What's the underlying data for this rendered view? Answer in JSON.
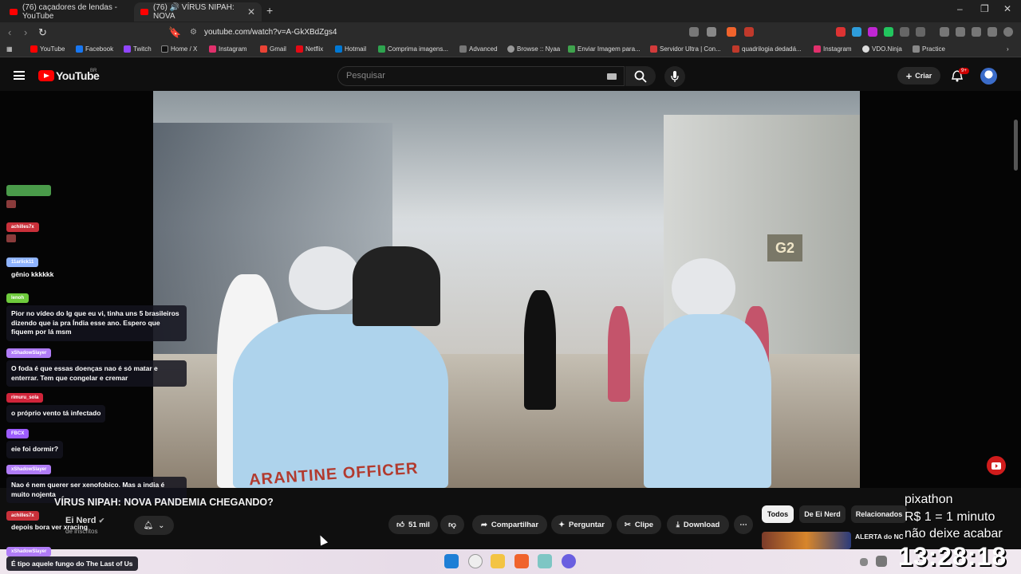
{
  "browser": {
    "tabs": [
      {
        "label": "(76) caçadores de lendas - YouTube"
      },
      {
        "label": "(76) 🔊 VÍRUS NIPAH: NOVA"
      }
    ],
    "url": "youtube.com/watch?v=A-GkXBdZgs4",
    "bookmarks": [
      {
        "label": "YouTube",
        "color": "#ff0000"
      },
      {
        "label": "Facebook",
        "color": "#1877f2"
      },
      {
        "label": "Twitch",
        "color": "#9146ff"
      },
      {
        "label": "Home / X",
        "color": "#222222"
      },
      {
        "label": "Instagram",
        "color": "#e1306c"
      },
      {
        "label": "Gmail",
        "color": "#ea4335"
      },
      {
        "label": "Netflix",
        "color": "#e50914"
      },
      {
        "label": "Hotmail",
        "color": "#0078d4"
      },
      {
        "label": "Comprima imagens...",
        "color": "#2ea44f"
      },
      {
        "label": "Advanced",
        "color": "#777777"
      },
      {
        "label": "Browse :: Nyaa",
        "color": "#999999"
      },
      {
        "label": "Enviar Imagem para...",
        "color": "#3fa34d"
      },
      {
        "label": "Servidor Ultra | Con...",
        "color": "#d33b3b"
      },
      {
        "label": "quadrilogia dedadá...",
        "color": "#c0392b"
      },
      {
        "label": "Instagram",
        "color": "#e1306c"
      },
      {
        "label": "VDO.Ninja",
        "color": "#dddddd"
      },
      {
        "label": "Practice",
        "color": "#888888"
      }
    ]
  },
  "youtube": {
    "logo_text": "YouTube",
    "country_code": "BR",
    "search_placeholder": "Pesquisar",
    "create_label": "Criar",
    "notification_count": "9+"
  },
  "video": {
    "title": "VÍRUS NIPAH: NOVA PANDEMIA CHEGANDO?",
    "gate_sign": "G2",
    "officer_text": "ARANTINE OFFICER",
    "channel": "Ei Nerd",
    "subscribers": "de inscritos",
    "likes": "51 mil",
    "share_label": "Compartilhar",
    "ask_label": "Perguntar",
    "clip_label": "Clipe",
    "download_label": "Download"
  },
  "chips": [
    "Todos",
    "De Ei Nerd",
    "Relacionados"
  ],
  "recommendation": {
    "title": "ALERTA do NOVO NIPAH! CASOS CONFIRMADOS"
  },
  "chat": [
    {
      "user": "",
      "message": "",
      "name_color": "#4a9b4a"
    },
    {
      "user": "achilles7x",
      "message": "",
      "name_color": "#c9303a"
    },
    {
      "user": "11arlick11",
      "message": "gênio kkkkkk",
      "name_color": "#8fb4ff"
    },
    {
      "user": "lenoh",
      "message": "Pior no vídeo do Ig que eu vi, tinha uns 5 brasileiros dizendo que ia pra Índia esse ano. Espero que fiquem por lá msm",
      "name_color": "#6ecb3c"
    },
    {
      "user": "xShadowSlayer",
      "message": "O foda é que essas doenças nao é só matar e enterrar. Tem que congelar e cremar",
      "name_color": "#b07cf7"
    },
    {
      "user": "rimuru_sola",
      "message": "o próprio vento tá infectado",
      "name_color": "#d0243a"
    },
    {
      "user": "FBCX",
      "message": "eie foi dormir?",
      "name_color": "#9d5cff"
    },
    {
      "user": "xShadowSlayer",
      "message": "Nao é nem querer ser xenofobico. Mas a india é muito nojenta",
      "name_color": "#b07cf7"
    },
    {
      "user": "achilles7x",
      "message": "depois bora ver xracing",
      "name_color": "#c9303a"
    },
    {
      "user": "xShadowSlayer",
      "message": "É tipo aquele fungo do The Last of Us",
      "name_color": "#b07cf7"
    }
  ],
  "overlay": {
    "line1": "pixathon",
    "line2": "R$ 1 = 1 minuto",
    "line3": "não deixe acabar",
    "timer": "13:28:18"
  }
}
